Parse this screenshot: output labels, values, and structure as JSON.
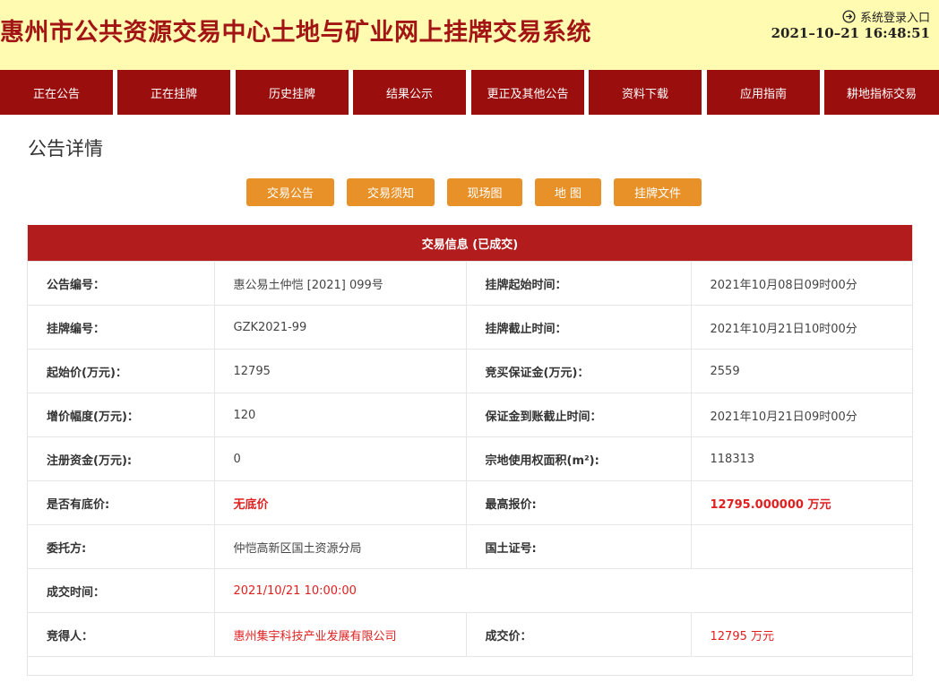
{
  "header": {
    "title": "惠州市公共资源交易中心土地与矿业网上挂牌交易系统",
    "login_label": "系统登录入口",
    "datetime": "2021–10–21 16:48:51"
  },
  "nav": {
    "items": [
      {
        "label": "正在公告"
      },
      {
        "label": "正在挂牌"
      },
      {
        "label": "历史挂牌"
      },
      {
        "label": "结果公示"
      },
      {
        "label": "更正及其他公告"
      },
      {
        "label": "资料下载"
      },
      {
        "label": "应用指南"
      },
      {
        "label": "耕地指标交易"
      }
    ]
  },
  "page": {
    "title": "公告详情"
  },
  "actions": [
    {
      "label": "交易公告"
    },
    {
      "label": "交易须知"
    },
    {
      "label": "现场图"
    },
    {
      "label": "地 图"
    },
    {
      "label": "挂牌文件"
    }
  ],
  "panel": {
    "title": "交易信息 (已成交)",
    "rows": [
      {
        "l1": "公告编号：",
        "v1": "惠公易土仲恺 [2021] 099号",
        "l2": "挂牌起始时间：",
        "v2": "2021年10月08日09时00分"
      },
      {
        "l1": "挂牌编号：",
        "v1": "GZK2021-99",
        "l2": "挂牌截止时间：",
        "v2": "2021年10月21日10时00分"
      },
      {
        "l1": "起始价(万元)：",
        "v1": "12795",
        "l2": "竞买保证金(万元)：",
        "v2": "2559"
      },
      {
        "l1": "增价幅度(万元)：",
        "v1": "120",
        "l2": "保证金到账截止时间：",
        "v2": "2021年10月21日09时00分"
      },
      {
        "l1": "注册资金(万元):",
        "v1": "0",
        "l2": "宗地使用权面积(m²):",
        "v2": "118313"
      },
      {
        "l1": "是否有底价:",
        "v1": "无底价",
        "l2": "最高报价:",
        "v2": "12795.000000 万元"
      },
      {
        "l1": "委托方:",
        "v1": "仲恺高新区国土资源分局",
        "l2": "国土证号:",
        "v2": ""
      },
      {
        "l1": "成交时间：",
        "v1": "2021/10/21 10:00:00"
      },
      {
        "l1": "竞得人：",
        "v1": "惠州集宇科技产业发展有限公司",
        "l2": "成交价：",
        "v2": "12795 万元"
      }
    ]
  },
  "colors": {
    "header_bg": "#fffbb0",
    "title_red": "#a31515",
    "nav_bg": "#9b0e0e",
    "button_orange": "#e79128",
    "panel_head_red": "#b21c1c",
    "highlight_red": "#e02020"
  },
  "icons": {
    "login": "arrow-right-circle-icon"
  }
}
